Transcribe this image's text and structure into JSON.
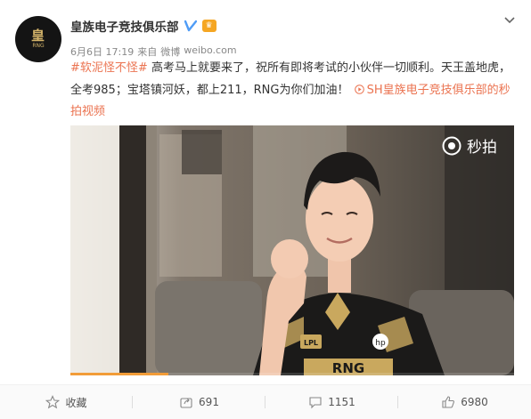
{
  "post": {
    "author": "皇族电子竞技俱乐部",
    "avatar_logo": "皇",
    "avatar_logo_sub": "RNG",
    "date": "6月6日 17:19",
    "source_prefix": "来自",
    "source_app": "微博",
    "source_site": "weibo.com",
    "hashtag": "#软泥怪不怪#",
    "body_main": "高考马上就要来了，祝所有即将考试的小伙伴一切顺利。天王盖地虎，全考985；宝塔镇河妖，都上211，RNG为你们加油！",
    "video_link_text": "SH皇族电子竞技俱乐部的秒拍视频"
  },
  "video": {
    "watermark_text": "秒拍",
    "progress": 0.22,
    "jersey_patches": [
      "LPL",
      "hp",
      "RNG"
    ]
  },
  "actions": [
    {
      "icon": "star-icon",
      "label": "收藏"
    },
    {
      "icon": "share-icon",
      "label": "691"
    },
    {
      "icon": "comment-icon",
      "label": "1151"
    },
    {
      "icon": "like-icon",
      "label": "6980"
    }
  ],
  "colors": {
    "accent": "#eb7350",
    "progress": "#f29c38",
    "verified": "#4f9cf6"
  }
}
